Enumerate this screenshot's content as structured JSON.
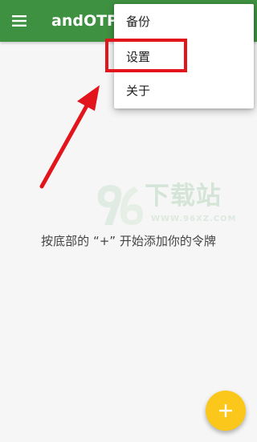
{
  "app_bar": {
    "title": "andOTP",
    "menu_icon": "hamburger-menu-icon",
    "background_color": "#3f9142"
  },
  "overflow_menu": {
    "items": [
      {
        "label": "备份"
      },
      {
        "label": "设置",
        "highlighted": true
      },
      {
        "label": "关于"
      }
    ]
  },
  "empty_state": {
    "message": "按底部的 “+” 开始添加你的令牌"
  },
  "watermark": {
    "logo_text": "96",
    "title": "下载站",
    "url": "WWW.96XZ.COM"
  },
  "annotation": {
    "arrow_icon": "red-arrow-pointer",
    "highlight_color": "#e2141c"
  },
  "fab": {
    "icon": "plus-icon",
    "color": "#fbc71a"
  }
}
